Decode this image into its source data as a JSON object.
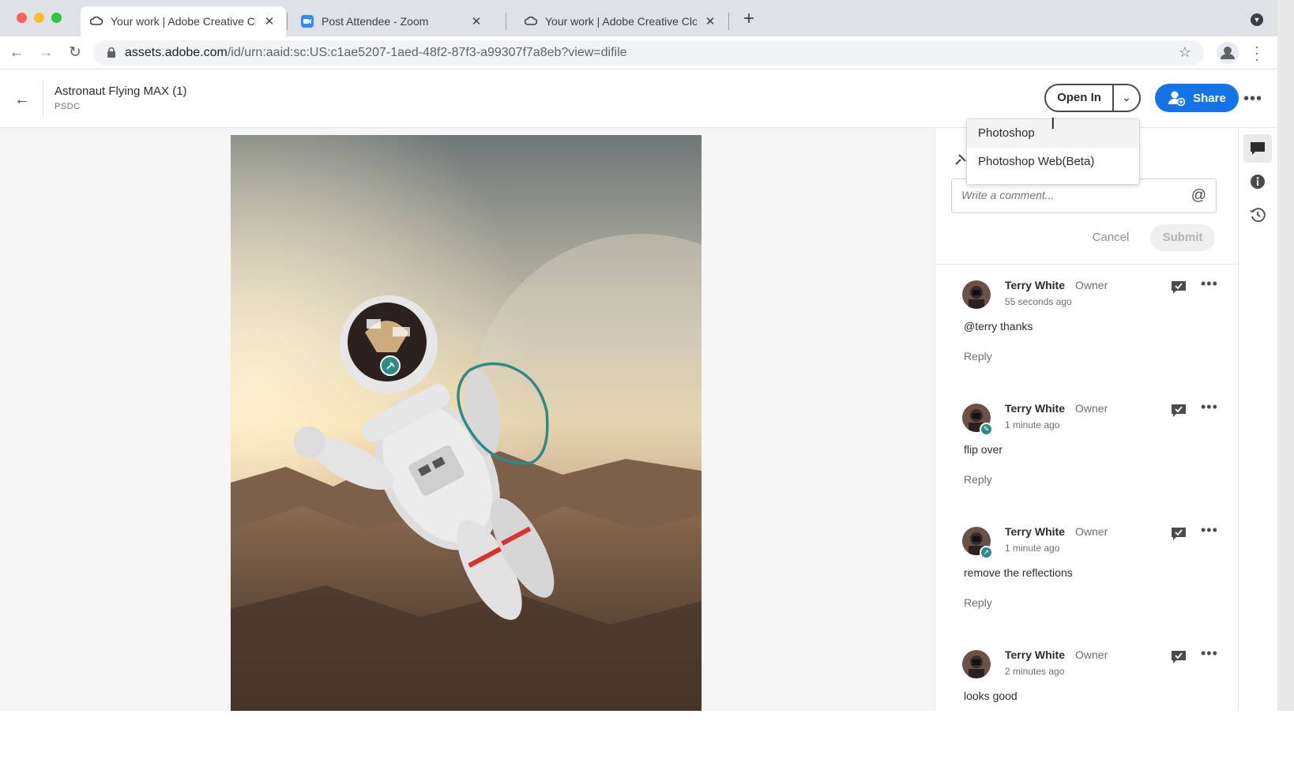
{
  "browser": {
    "tabs": [
      {
        "title": "Your work | Adobe Creative Cloud",
        "active": true
      },
      {
        "title": "Post Attendee - Zoom",
        "active": false
      },
      {
        "title": "Your work | Adobe Creative Cloud",
        "active": false
      }
    ],
    "new_tab_label": "+",
    "url_host": "assets.adobe.com",
    "url_path": "/id/urn:aaid:sc:US:c1ae5207-1aed-48f2-87f3-a99307f7a8eb?view=difile"
  },
  "header": {
    "file_title": "Astronaut Flying MAX (1)",
    "file_type": "PSDC",
    "open_in_label": "Open In",
    "share_label": "Share"
  },
  "open_in_menu": {
    "items": [
      "Photoshop",
      "Photoshop Web(Beta)"
    ]
  },
  "comment_box": {
    "placeholder": "Write a comment...",
    "cancel_label": "Cancel",
    "submit_label": "Submit"
  },
  "comments": [
    {
      "author": "Terry White",
      "role": "Owner",
      "time": "55 seconds ago",
      "text": "@terry thanks",
      "reply_label": "Reply",
      "badge": ""
    },
    {
      "author": "Terry White",
      "role": "Owner",
      "time": "1 minute ago",
      "text": "flip over",
      "reply_label": "Reply",
      "badge": "pencil-icon"
    },
    {
      "author": "Terry White",
      "role": "Owner",
      "time": "1 minute ago",
      "text": "remove the reflections",
      "reply_label": "Reply",
      "badge": "pin-icon"
    },
    {
      "author": "Terry White",
      "role": "Owner",
      "time": "2 minutes ago",
      "text": "looks good",
      "reply_label": "Reply",
      "badge": ""
    }
  ],
  "rail": [
    "comments-icon",
    "info-icon",
    "history-icon"
  ],
  "colors": {
    "accent": "#1473e6",
    "annotation": "#2d8a86"
  }
}
